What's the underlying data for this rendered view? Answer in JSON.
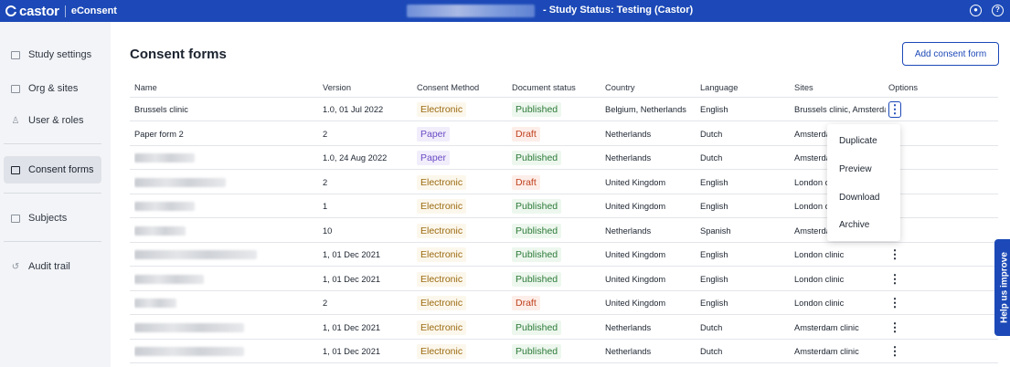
{
  "topbar": {
    "brand": "castor",
    "product": "eConsent",
    "study_status": "- Study Status: Testing (Castor)",
    "user_icon": "user-icon",
    "help_icon": "help-icon"
  },
  "sidebar": {
    "items": [
      {
        "label": "Study settings",
        "icon": "study-settings-icon"
      },
      {
        "label": "Org & sites",
        "icon": "org-sites-icon"
      },
      {
        "label": "User & roles",
        "icon": "users-icon"
      },
      {
        "label": "Consent forms",
        "icon": "consent-forms-icon",
        "active": true
      },
      {
        "label": "Subjects",
        "icon": "subjects-icon"
      },
      {
        "label": "Audit trail",
        "icon": "history-icon"
      }
    ]
  },
  "main": {
    "title": "Consent forms",
    "add_button": "Add consent form"
  },
  "table": {
    "headers": [
      "Name",
      "Version",
      "Consent Method",
      "Document status",
      "Country",
      "Language",
      "Sites",
      "Options"
    ],
    "rows": [
      {
        "name": "Brussels clinic",
        "version": "1.0, 01 Jul 2022",
        "method": "Electronic",
        "status": "Published",
        "country": "Belgium, Netherlands",
        "language": "English",
        "sites": "Brussels clinic, Amsterda"
      },
      {
        "name": "Paper form 2",
        "version": "2",
        "method": "Paper",
        "status": "Draft",
        "country": "Netherlands",
        "language": "Dutch",
        "sites": "Amsterda"
      },
      {
        "name": "",
        "version": "1.0, 24 Aug 2022",
        "method": "Paper",
        "status": "Published",
        "country": "Netherlands",
        "language": "Dutch",
        "sites": "Amsterda"
      },
      {
        "name": "",
        "version": "2",
        "method": "Electronic",
        "status": "Draft",
        "country": "United Kingdom",
        "language": "English",
        "sites": "London cl"
      },
      {
        "name": "",
        "version": "1",
        "method": "Electronic",
        "status": "Published",
        "country": "United Kingdom",
        "language": "English",
        "sites": "London cl"
      },
      {
        "name": "",
        "version": "10",
        "method": "Electronic",
        "status": "Published",
        "country": "Netherlands",
        "language": "Spanish",
        "sites": "Amsterda"
      },
      {
        "name": "",
        "version": "1, 01 Dec 2021",
        "method": "Electronic",
        "status": "Published",
        "country": "United Kingdom",
        "language": "English",
        "sites": "London clinic"
      },
      {
        "name": "",
        "version": "1, 01 Dec 2021",
        "method": "Electronic",
        "status": "Published",
        "country": "United Kingdom",
        "language": "English",
        "sites": "London clinic"
      },
      {
        "name": "",
        "version": "2",
        "method": "Electronic",
        "status": "Draft",
        "country": "United Kingdom",
        "language": "English",
        "sites": "London clinic"
      },
      {
        "name": "",
        "version": "1, 01 Dec 2021",
        "method": "Electronic",
        "status": "Published",
        "country": "Netherlands",
        "language": "Dutch",
        "sites": "Amsterdam clinic"
      },
      {
        "name": "",
        "version": "1, 01 Dec 2021",
        "method": "Electronic",
        "status": "Published",
        "country": "Netherlands",
        "language": "Dutch",
        "sites": "Amsterdam clinic"
      }
    ]
  },
  "options_menu": {
    "items": [
      "Duplicate",
      "Preview",
      "Download",
      "Archive"
    ]
  },
  "feedback_tab": "Help us improve",
  "colors": {
    "brand": "#1c49b7",
    "electronic": "#9a6a10",
    "paper": "#6b4bc4",
    "published": "#2c7a37",
    "draft": "#c0401e"
  }
}
